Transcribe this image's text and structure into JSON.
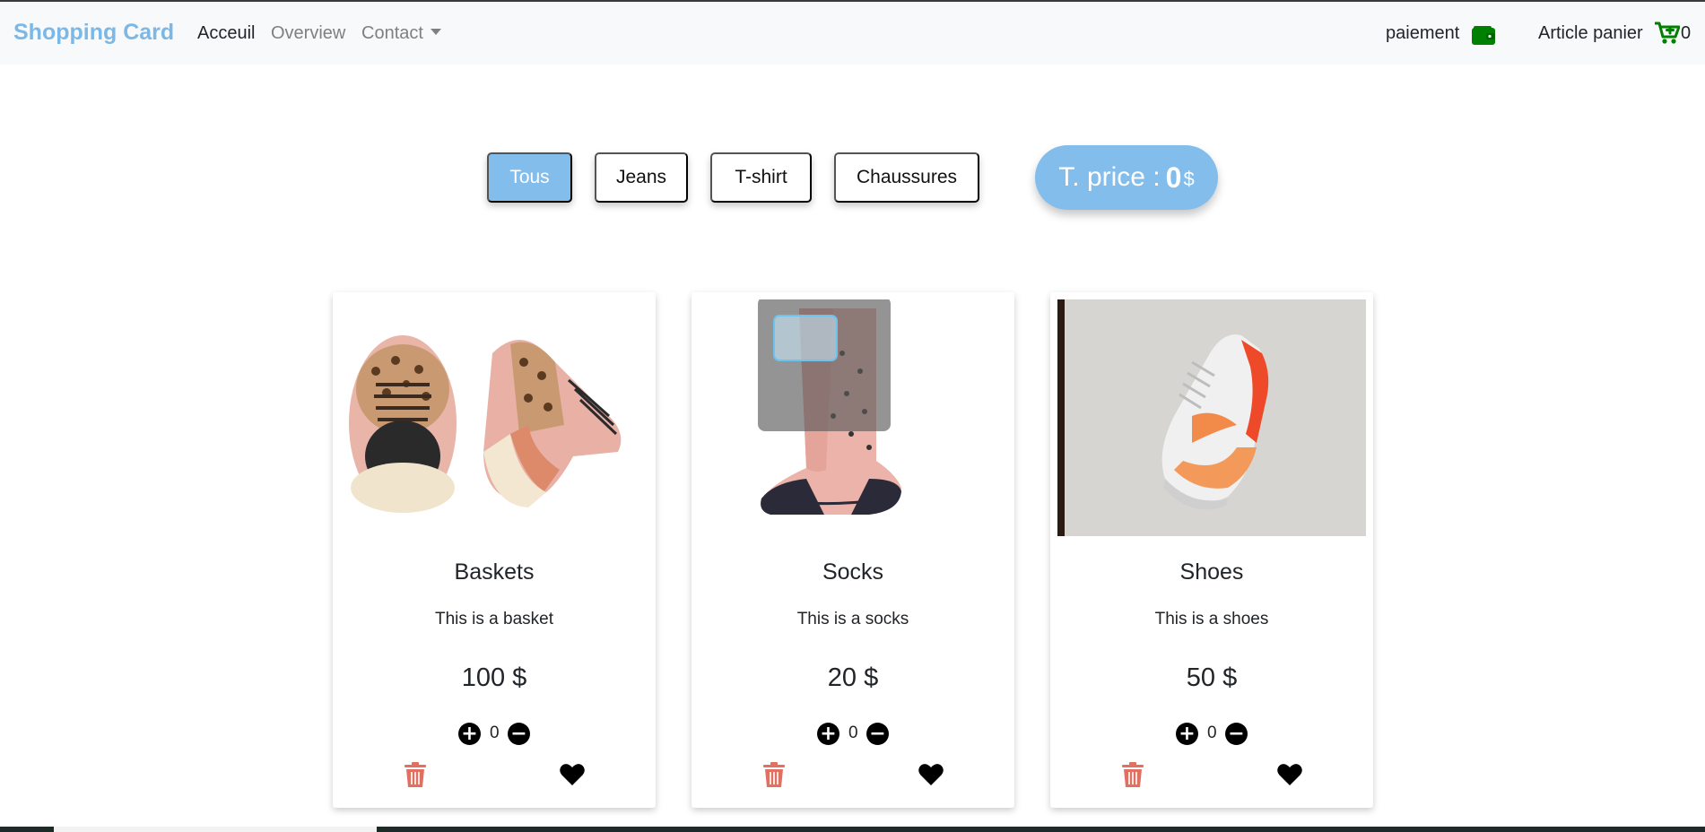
{
  "navbar": {
    "brand": "Shopping Card",
    "links": [
      {
        "label": "Acceuil"
      },
      {
        "label": "Overview"
      },
      {
        "label": "Contact"
      }
    ],
    "payment_label": "paiement",
    "cart_label": "Article panier",
    "cart_count": "0",
    "icons": {
      "wallet": "wallet-icon",
      "cart": "cart-plus-icon"
    },
    "accent_color": "#008000"
  },
  "filters": {
    "items": [
      {
        "label": "Tous",
        "active": true
      },
      {
        "label": "Jeans",
        "active": false
      },
      {
        "label": "T-shirt",
        "active": false
      },
      {
        "label": "Chaussures",
        "active": false
      }
    ],
    "active_color": "#82bdec"
  },
  "total": {
    "label": "T. price :",
    "value": "0",
    "currency": "$"
  },
  "products": [
    {
      "title": "Baskets",
      "description": "This is a basket",
      "price": "100 $",
      "quantity": "0"
    },
    {
      "title": "Socks",
      "description": "This is a socks",
      "price": "20 $",
      "quantity": "0"
    },
    {
      "title": "Shoes",
      "description": "This is a shoes",
      "price": "50 $",
      "quantity": "0"
    }
  ],
  "controls": {
    "plus": "+",
    "minus": "−",
    "trash_color": "#e07060",
    "heart_color": "#000000"
  }
}
